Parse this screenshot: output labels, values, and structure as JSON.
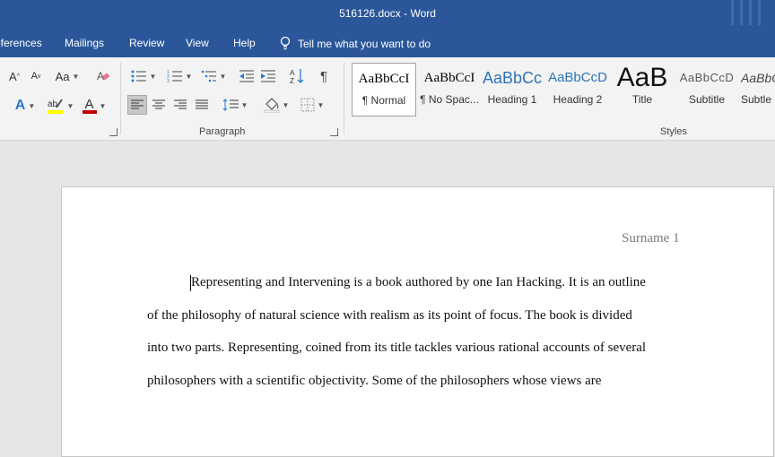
{
  "window": {
    "title": "516126.docx  -  Word"
  },
  "menu": {
    "tabs": [
      "eferences",
      "Mailings",
      "Review",
      "View",
      "Help"
    ],
    "tell_me": "Tell me what you want to do"
  },
  "ribbon": {
    "font_group": {
      "grow_font": "A",
      "shrink_font": "A",
      "change_case": "Aa",
      "text_effects": "A",
      "font_color": "A",
      "font_color_hex": "#c00000",
      "highlight_color_hex": "#ffff00"
    },
    "paragraph_group": {
      "label": "Paragraph",
      "pilcrow": "¶"
    },
    "styles_group": {
      "label": "Styles",
      "tiles": [
        {
          "sample": "AaBbCcI",
          "name": "¶ Normal"
        },
        {
          "sample": "AaBbCcI",
          "name": "¶ No Spac..."
        },
        {
          "sample": "AaBbCc",
          "name": "Heading 1"
        },
        {
          "sample": "AaBbCcD",
          "name": "Heading 2"
        },
        {
          "sample": "AaB",
          "name": "Title"
        },
        {
          "sample": "AaBbCcD",
          "name": "Subtitle"
        },
        {
          "sample": "AaBbCc",
          "name": "Subtle"
        }
      ]
    }
  },
  "document": {
    "header": "Surname   1",
    "lines": [
      "Representing and Intervening is a book authored by one Ian Hacking. It is an outline",
      "of the philosophy of natural science with realism as its point of focus. The book is divided",
      "into two parts. Representing, coined from its title tackles various rational accounts of several",
      "philosophers with a scientific objectivity. Some of the philosophers whose views are"
    ]
  }
}
